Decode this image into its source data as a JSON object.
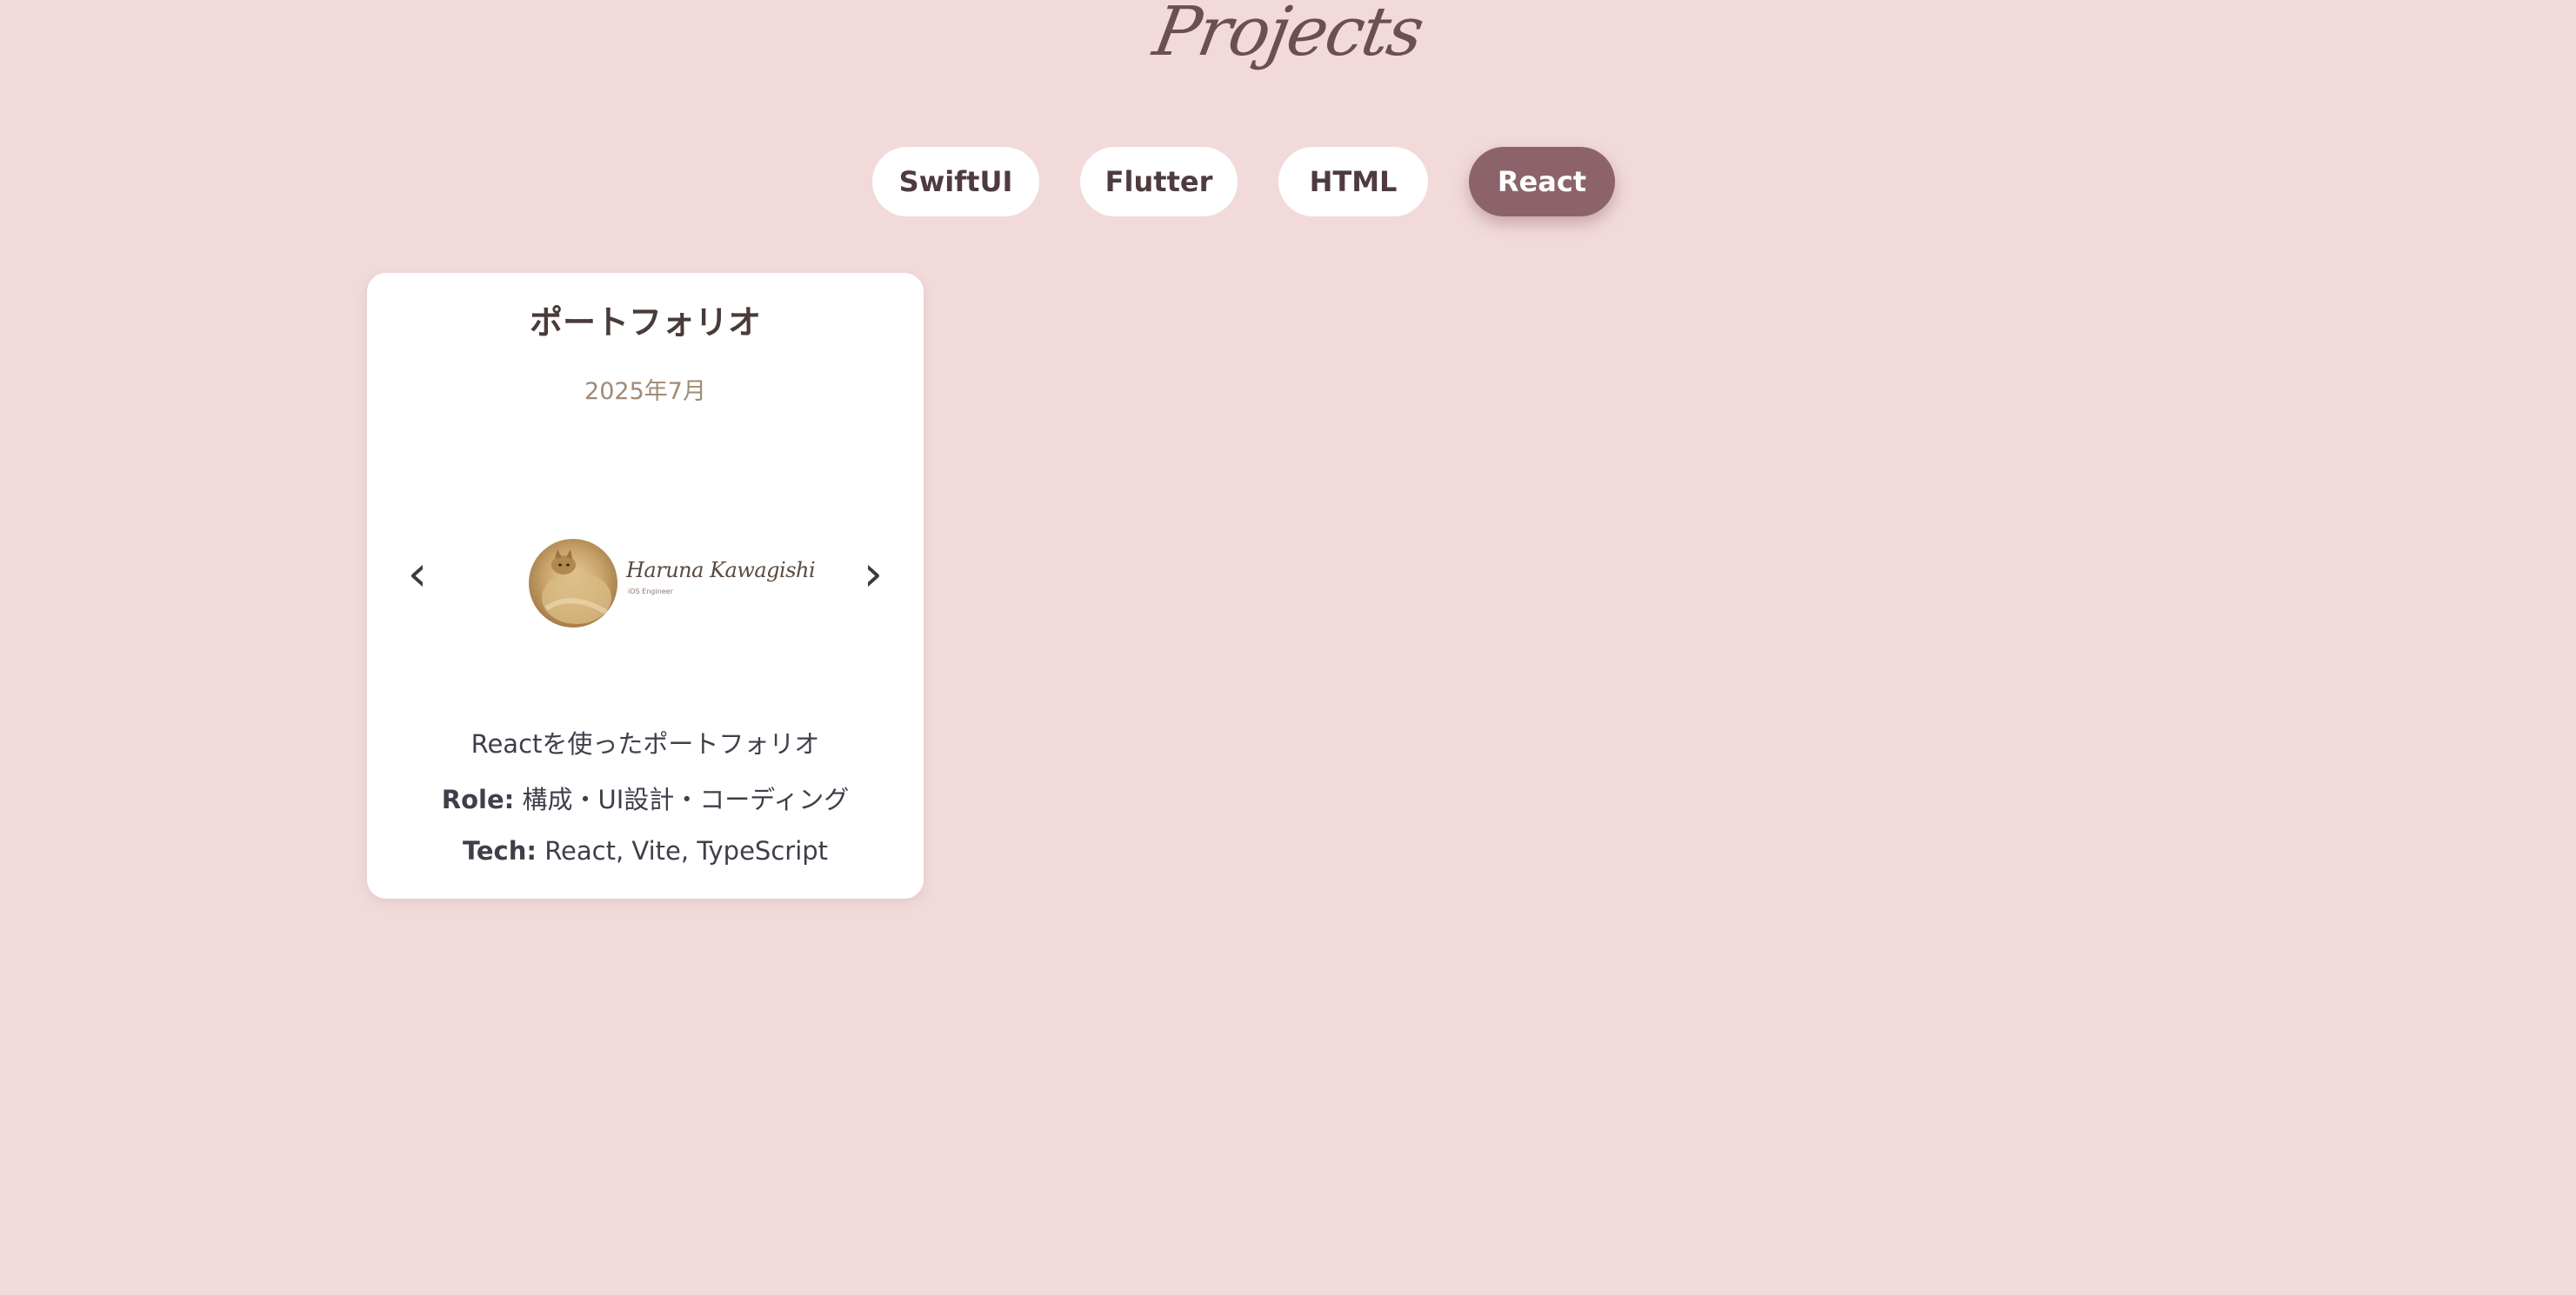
{
  "page": {
    "title": "Projects"
  },
  "filters": [
    {
      "label": "SwiftUI",
      "active": false
    },
    {
      "label": "Flutter",
      "active": false
    },
    {
      "label": "HTML",
      "active": false
    },
    {
      "label": "React",
      "active": true
    }
  ],
  "project": {
    "title": "ポートフォリオ",
    "date": "2025年7月",
    "carousel": {
      "prev_icon": "‹",
      "next_icon": "›",
      "logo_name": "Haruna Kawagishi",
      "logo_sub": "iOS Engineer"
    },
    "description": "Reactを使ったポートフォリオ",
    "role_label": "Role:",
    "role_value": "構成・UI設計・コーディング",
    "tech_label": "Tech:",
    "tech_value": "React, Vite, TypeScript"
  },
  "colors": {
    "background": "#f2dadb",
    "active_filter": "#8c636a",
    "card": "#ffffff",
    "date_text": "#a08a74"
  }
}
